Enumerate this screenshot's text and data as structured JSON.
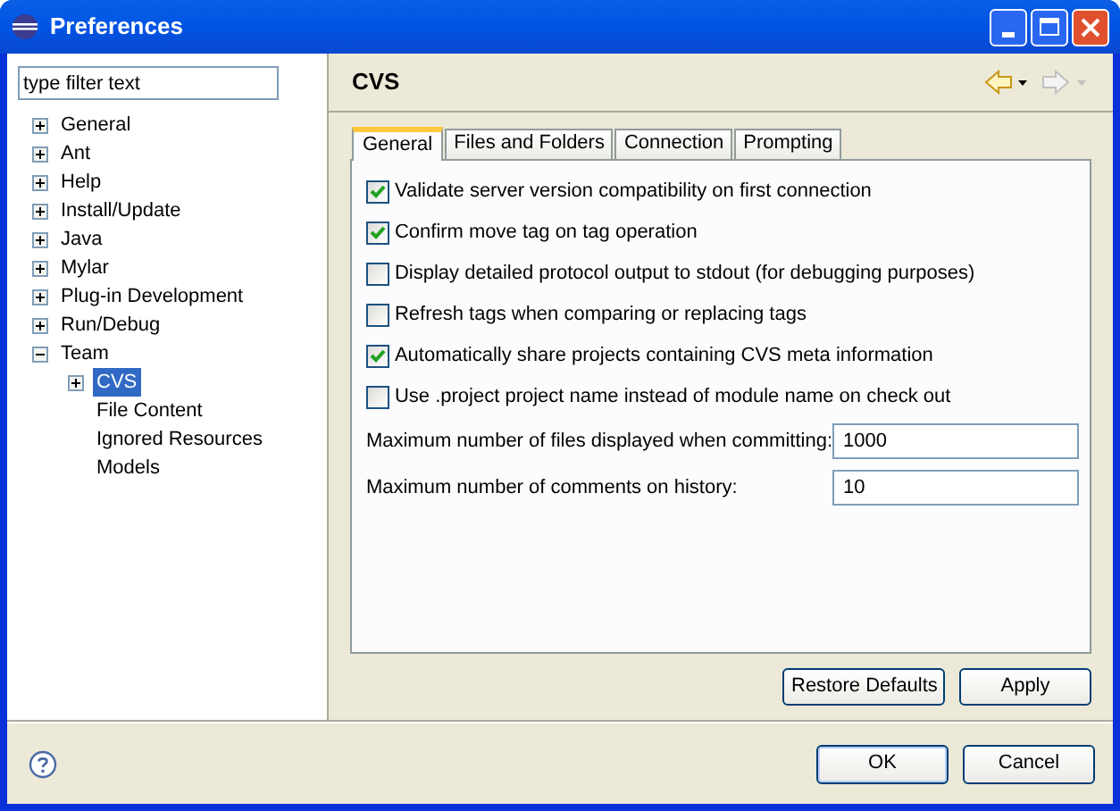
{
  "window": {
    "title": "Preferences"
  },
  "filter": {
    "placeholder": "type filter text"
  },
  "tree": [
    {
      "label": "General",
      "kind": "branch",
      "expanded": false,
      "selected": false
    },
    {
      "label": "Ant",
      "kind": "branch",
      "expanded": false,
      "selected": false
    },
    {
      "label": "Help",
      "kind": "branch",
      "expanded": false,
      "selected": false
    },
    {
      "label": "Install/Update",
      "kind": "branch",
      "expanded": false,
      "selected": false
    },
    {
      "label": "Java",
      "kind": "branch",
      "expanded": false,
      "selected": false
    },
    {
      "label": "Mylar",
      "kind": "branch",
      "expanded": false,
      "selected": false
    },
    {
      "label": "Plug-in Development",
      "kind": "branch",
      "expanded": false,
      "selected": false
    },
    {
      "label": "Run/Debug",
      "kind": "branch",
      "expanded": false,
      "selected": false
    },
    {
      "label": "Team",
      "kind": "branch",
      "expanded": true,
      "selected": false,
      "children": [
        {
          "label": "CVS",
          "kind": "branch",
          "expanded": false,
          "selected": true
        },
        {
          "label": "File Content",
          "kind": "leaf",
          "selected": false
        },
        {
          "label": "Ignored Resources",
          "kind": "leaf",
          "selected": false
        },
        {
          "label": "Models",
          "kind": "leaf",
          "selected": false
        }
      ]
    }
  ],
  "page": {
    "title": "CVS"
  },
  "tabs": [
    {
      "label": "General",
      "selected": true
    },
    {
      "label": "Files and Folders",
      "selected": false
    },
    {
      "label": "Connection",
      "selected": false
    },
    {
      "label": "Prompting",
      "selected": false
    }
  ],
  "options": [
    {
      "label": "Validate server version compatibility on first connection",
      "checked": true
    },
    {
      "label": "Confirm move tag on tag operation",
      "checked": true
    },
    {
      "label": "Display detailed protocol output to stdout (for debugging purposes)",
      "checked": false
    },
    {
      "label": "Refresh tags when comparing or replacing tags",
      "checked": false
    },
    {
      "label": "Automatically share projects containing CVS meta information",
      "checked": true
    },
    {
      "label": "Use .project project name instead of module name on check out",
      "checked": false
    }
  ],
  "fields": [
    {
      "label": "Maximum number of files displayed when committing:",
      "value": "1000"
    },
    {
      "label": "Maximum number of comments on history:",
      "value": "10"
    }
  ],
  "page_buttons": [
    "Restore Defaults",
    "Apply"
  ],
  "dialog_buttons": [
    "OK",
    "Cancel"
  ]
}
